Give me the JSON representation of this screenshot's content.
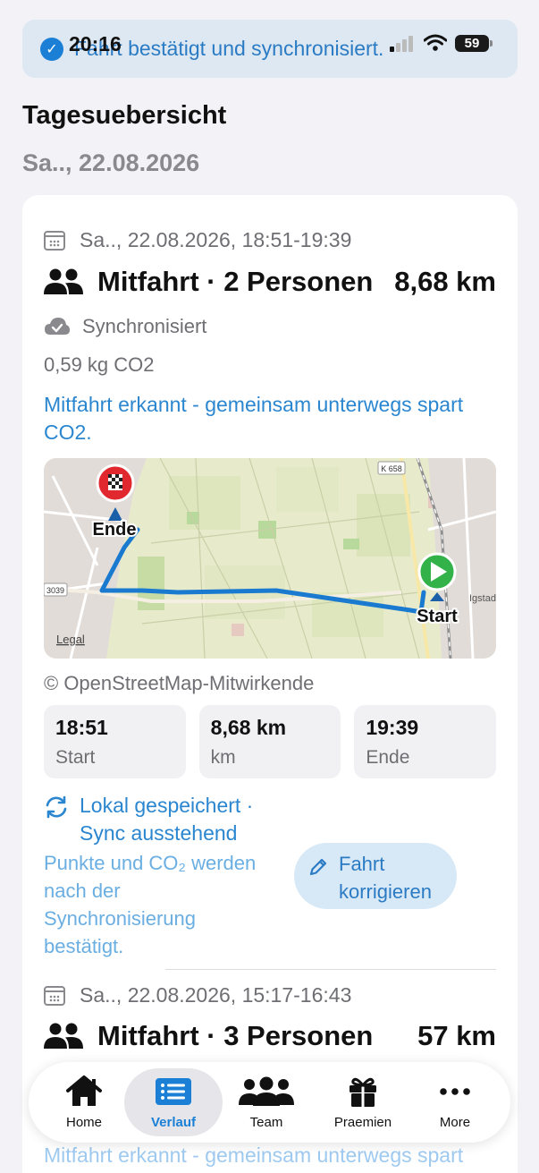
{
  "status": {
    "time": "20:16",
    "battery": "59"
  },
  "banner": {
    "text": "Fahrt bestätigt und synchronisiert."
  },
  "page": {
    "title": "Tagesuebersicht",
    "date": "Sa.., 22.08.2026"
  },
  "trip1": {
    "date": "Sa.., 22.08.2026, 18:51-19:39",
    "title": "Mitfahrt · 2 Personen",
    "distance": "8,68 km",
    "sync": "Synchronisiert",
    "co2": "0,59 kg CO2",
    "hint_line1": "Mitfahrt erkannt - gemeinsam unterwegs spart",
    "hint_line2": "CO2.",
    "map": {
      "end_label": "Ende",
      "start_label": "Start",
      "legal": "Legal",
      "road_k658": "K 658",
      "road_3039": "3039",
      "place": "Igstad"
    },
    "attribution": "© OpenStreetMap-Mitwirkende",
    "tiles": [
      {
        "value": "18:51",
        "label": "Start"
      },
      {
        "value": "8,68 km",
        "label": "km"
      },
      {
        "value": "19:39",
        "label": "Ende"
      }
    ],
    "local_line1": "Lokal gespeichert ·",
    "local_line2": "Sync ausstehend",
    "note_lines": [
      "Punkte und CO₂ werden",
      "nach der",
      "Synchronisierung",
      "bestätigt."
    ],
    "fix_line1": "Fahrt",
    "fix_line2": "korrigieren"
  },
  "trip2": {
    "date": "Sa.., 22.08.2026, 15:17-16:43",
    "title": "Mitfahrt · 3 Personen",
    "distance": "57 km",
    "hint": "Mitfahrt erkannt - gemeinsam unterwegs spart"
  },
  "tabbar": {
    "items": [
      {
        "label": "Home"
      },
      {
        "label": "Verlauf"
      },
      {
        "label": "Team"
      },
      {
        "label": "Praemien"
      },
      {
        "label": "More"
      }
    ]
  },
  "colors": {
    "accent": "#1b7fd6",
    "route": "#1a7ad0",
    "background": "#f2f2f7"
  }
}
